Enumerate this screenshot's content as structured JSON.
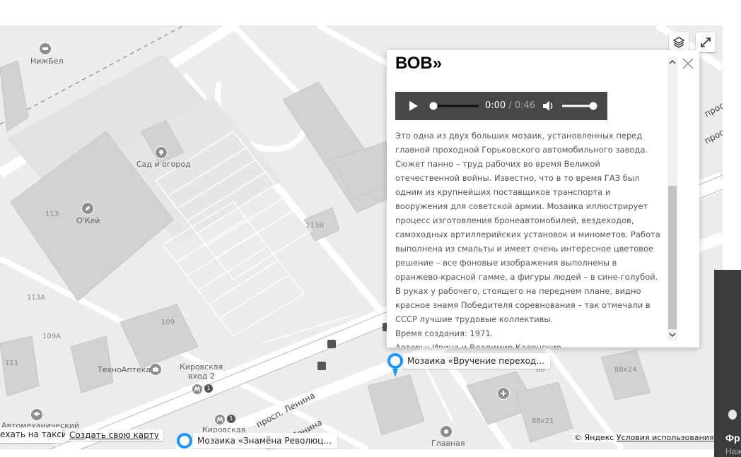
{
  "map": {
    "labels": {
      "nizhbel": "НижБел",
      "sad": "Сад и огород",
      "okey": "О'Кей",
      "technoapteka": "ТехноАптека",
      "kirovskaya2": "Кировская вход 2",
      "kirovskaya2_line1": "Кировская",
      "kirovskaya2_line2": "вход 2",
      "kirovskaya": "Кировская",
      "avtomeh": "Автомеханический",
      "glavnaya": "Главная"
    },
    "numbers": [
      "113",
      "113В",
      "113А",
      "109А",
      "109",
      "111",
      "88к24",
      "88к21",
      "88"
    ],
    "streets": [
      "просп. Ленина",
      "просп. Ленина",
      "просп. Ле",
      "просп"
    ],
    "metro_badge": "1",
    "controls": {
      "layers_icon": "layers-icon",
      "fullscreen_icon": "fullscreen-icon"
    }
  },
  "balloon": {
    "title": "ВОВ»",
    "audio": {
      "current": "0:00",
      "separator": " / ",
      "duration": "0:46",
      "progress": 0,
      "volume": 1.0
    },
    "description": "Это одна из двух больших мозаик, установленных перед главной проходной Горьковского автомобильного завода. Сюжет панно – труд рабочих во время Великой отечественной войны. Известно, что в то время ГАЗ был одним из крупнейших поставщиков транспорта и вооружения для советской армии. Мозаика иллюстрирует процесс изготовления бронеавтомобилей, вездеходов, самоходных артиллерийских установок и минометов. Работа выполнена из смальты и имеет очень интересное цветовое решение – все фоновые изображения выполнены в оранжево-красной гамме, а фигуры людей – в сине-голубой. В руках у рабочего, стоящего на переднем плане, видно красное знамя Победителя соревнования – так отмечали в СССР лучшие трудовые коллективы.",
    "created": "Время создания: 1971.",
    "authors": "Авторы: Ирина и Владимир Каленские"
  },
  "placemarks": [
    {
      "label": "Мозаика «Вручение переход…"
    },
    {
      "label": "Мозаика «Знамёна Революц…"
    }
  ],
  "footer": {
    "taxi": "ехать на такси",
    "create_map": "Создать свою карту",
    "copyright": "© Яндекс",
    "terms": "Условия использования"
  },
  "side_panel": {
    "text1": "Фр",
    "text2": "Наж"
  },
  "colors": {
    "accent_blue": "#1e98ff",
    "map_bg": "#ececec",
    "building": "#d4d4d4",
    "audio_bg": "#474747"
  }
}
